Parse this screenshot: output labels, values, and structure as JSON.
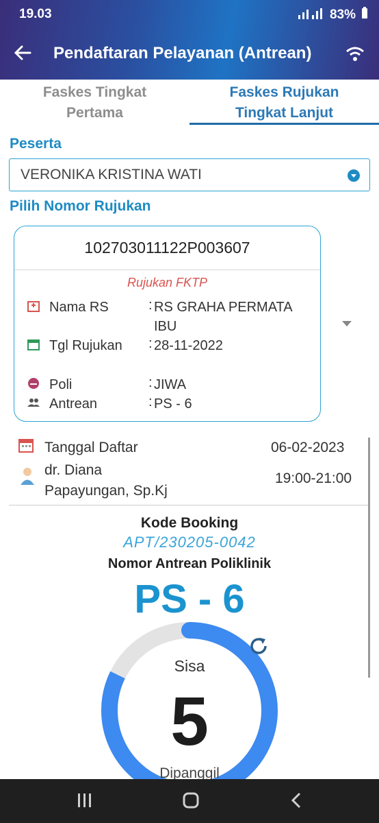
{
  "status": {
    "time": "19.03",
    "battery": "83%"
  },
  "appbar": {
    "title": "Pendaftaran Pelayanan (Antrean)"
  },
  "tabs": [
    {
      "line1": "Faskes Tingkat",
      "line2": "Pertama"
    },
    {
      "line1": "Faskes Rujukan",
      "line2": "Tingkat Lanjut"
    }
  ],
  "form": {
    "peserta_label": "Peserta",
    "peserta_value": "VERONIKA KRISTINA WATI",
    "rujukan_label": "Pilih Nomor Rujukan"
  },
  "rujukan": {
    "number": "102703011122P003607",
    "type": "Rujukan FKTP",
    "rows": [
      {
        "key": "Nama RS",
        "value": "RS GRAHA PERMATA IBU"
      },
      {
        "key": "Tgl Rujukan",
        "value": "28-11-2022"
      },
      {
        "key": "Poli",
        "value": "JIWA"
      },
      {
        "key": "Antrean",
        "value": "PS - 6"
      }
    ]
  },
  "schedule": {
    "tanggal_label": "Tanggal Daftar",
    "tanggal_value": "06-02-2023",
    "doctor_line1": "dr. Diana",
    "doctor_line2": "Papayungan, Sp.Kj",
    "time": "19:00-21:00"
  },
  "booking": {
    "kode_label": "Kode Booking",
    "kode_value": "APT/230205-0042",
    "antrean_label": "Nomor Antrean Poliklinik",
    "antrean_value": "PS - 6",
    "sisa_label": "Sisa",
    "sisa_value": "5",
    "dipanggil_label": "Dipanggil"
  },
  "colors": {
    "accent": "#1e8bc3",
    "gauge_fill": "#3d8af0",
    "gauge_track": "#e3e3e3"
  }
}
